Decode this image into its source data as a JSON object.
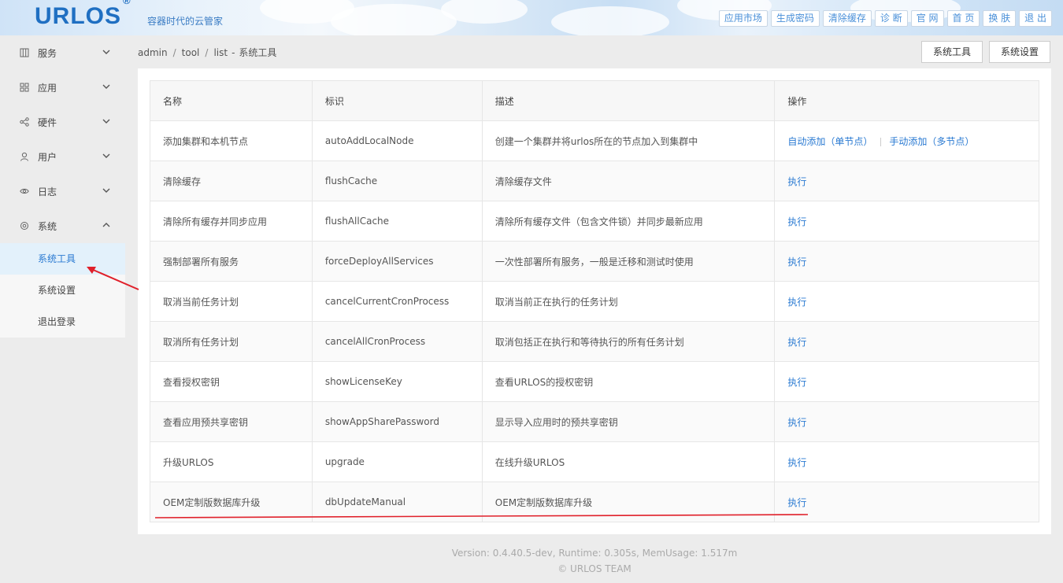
{
  "header": {
    "logo": "URLOS",
    "logo_mark": "®",
    "slogan": "容器时代的云管家",
    "nav": [
      "应用市场",
      "生成密码",
      "清除缓存",
      "诊 断",
      "官 网",
      "首 页",
      "换 肤",
      "退 出"
    ]
  },
  "sidebar": {
    "groups": [
      {
        "label": "服务",
        "icon": "service-icon"
      },
      {
        "label": "应用",
        "icon": "grid-icon"
      },
      {
        "label": "硬件",
        "icon": "share-icon"
      },
      {
        "label": "用户",
        "icon": "user-icon"
      },
      {
        "label": "日志",
        "icon": "eye-icon"
      },
      {
        "label": "系统",
        "icon": "gear-icon"
      }
    ],
    "submenu": [
      "系统工具",
      "系统设置",
      "退出登录"
    ]
  },
  "breadcrumb": [
    "admin",
    "/",
    "tool",
    "/",
    "list",
    "-",
    "系统工具"
  ],
  "top_buttons": [
    "系统工具",
    "系统设置"
  ],
  "table": {
    "headers": [
      "名称",
      "标识",
      "描述",
      "操作"
    ],
    "rows": [
      {
        "name": "添加集群和本机节点",
        "id": "autoAddLocalNode",
        "desc": "创建一个集群并将urlos所在的节点加入到集群中",
        "actions": [
          "自动添加（单节点）",
          "手动添加（多节点）"
        ]
      },
      {
        "name": "清除缓存",
        "id": "flushCache",
        "desc": "清除缓存文件",
        "actions": [
          "执行"
        ]
      },
      {
        "name": "清除所有缓存并同步应用",
        "id": "flushAllCache",
        "desc": "清除所有缓存文件（包含文件锁）并同步最新应用",
        "actions": [
          "执行"
        ]
      },
      {
        "name": "强制部署所有服务",
        "id": "forceDeployAllServices",
        "desc": "一次性部署所有服务，一般是迁移和测试时使用",
        "actions": [
          "执行"
        ]
      },
      {
        "name": "取消当前任务计划",
        "id": "cancelCurrentCronProcess",
        "desc": "取消当前正在执行的任务计划",
        "actions": [
          "执行"
        ]
      },
      {
        "name": "取消所有任务计划",
        "id": "cancelAllCronProcess",
        "desc": "取消包括正在执行和等待执行的所有任务计划",
        "actions": [
          "执行"
        ]
      },
      {
        "name": "查看授权密钥",
        "id": "showLicenseKey",
        "desc": "查看URLOS的授权密钥",
        "actions": [
          "执行"
        ]
      },
      {
        "name": "查看应用预共享密钥",
        "id": "showAppSharePassword",
        "desc": "显示导入应用时的预共享密钥",
        "actions": [
          "执行"
        ]
      },
      {
        "name": "升级URLOS",
        "id": "upgrade",
        "desc": "在线升级URLOS",
        "actions": [
          "执行"
        ]
      },
      {
        "name": "OEM定制版数据库升级",
        "id": "dbUpdateManual",
        "desc": "OEM定制版数据库升级",
        "actions": [
          "执行"
        ]
      }
    ]
  },
  "footer": {
    "version": "Version: 0.4.40.5-dev,   Runtime: 0.305s,   MemUsage: 1.517m",
    "copyright": "© URLOS TEAM"
  },
  "colors": {
    "link": "#2a7ad2",
    "annotation": "#e0202a"
  }
}
